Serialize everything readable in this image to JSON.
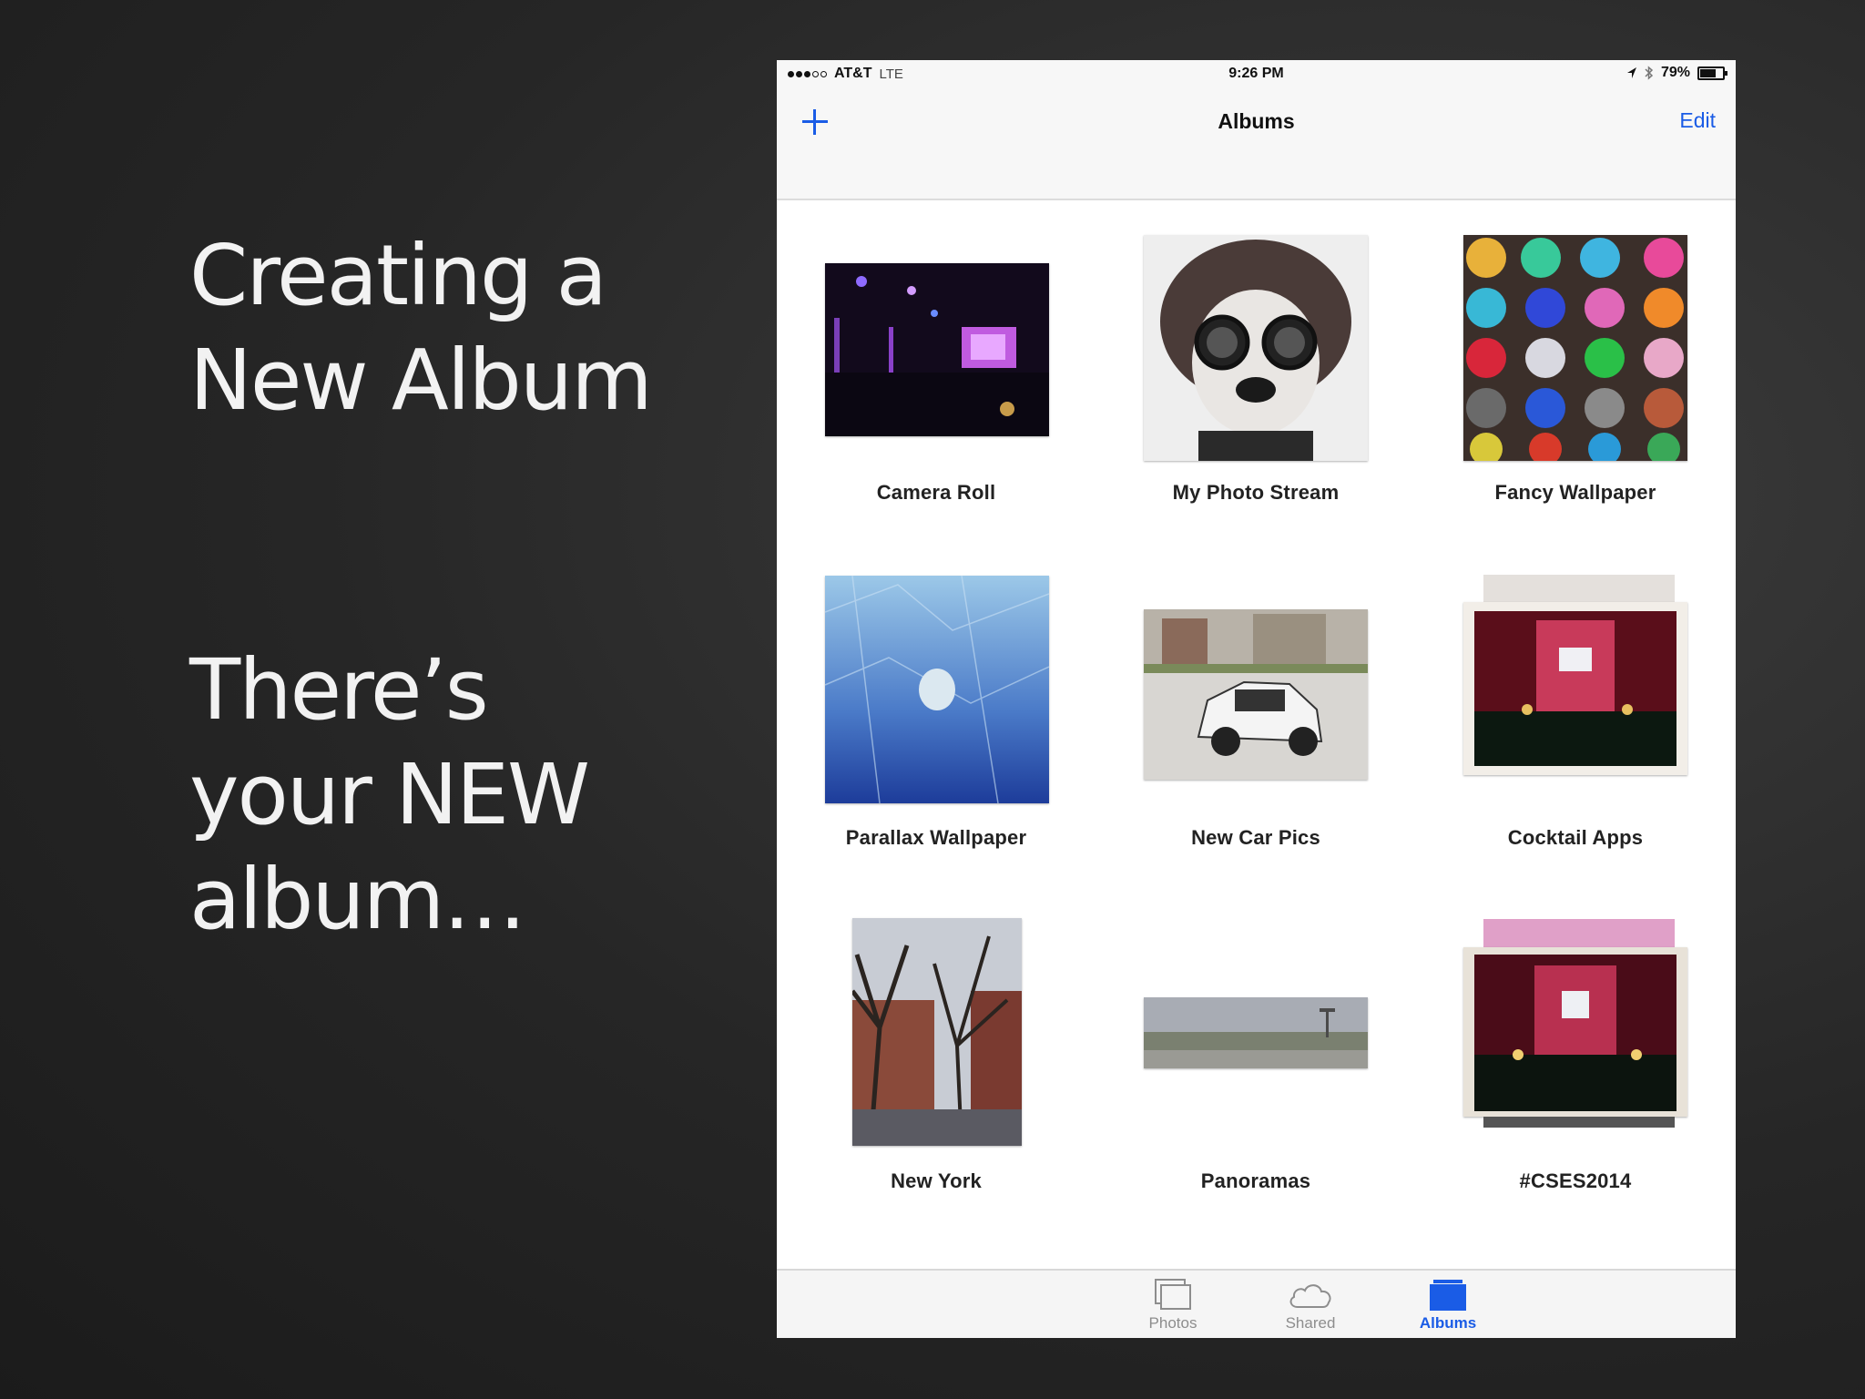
{
  "slide": {
    "heading_lines": [
      "Creating a",
      "New Album"
    ],
    "subheading_lines": [
      "There’s",
      "your NEW",
      "album…"
    ]
  },
  "status_bar": {
    "carrier": "AT&T",
    "network": "LTE",
    "time": "9:26 PM",
    "battery": "79%",
    "battery_level": 0.79,
    "icons": [
      "location-arrow-icon",
      "bluetooth-icon",
      "battery-icon"
    ]
  },
  "nav": {
    "title": "Albums",
    "edit_label": "Edit",
    "add_icon": "plus-icon"
  },
  "albums": [
    {
      "label": "Camera Roll"
    },
    {
      "label": "My Photo Stream"
    },
    {
      "label": "Fancy Wallpaper"
    },
    {
      "label": "Parallax Wallpaper"
    },
    {
      "label": "New Car Pics"
    },
    {
      "label": "Cocktail Apps"
    },
    {
      "label": "New York"
    },
    {
      "label": "Panoramas"
    },
    {
      "label": "#CSES2014"
    }
  ],
  "tabs": [
    {
      "label": "Photos",
      "icon": "photos-icon",
      "active": false
    },
    {
      "label": "Shared",
      "icon": "cloud-icon",
      "active": false
    },
    {
      "label": "Albums",
      "icon": "albums-icon",
      "active": true
    }
  ],
  "colors": {
    "accent": "#1a5ce6",
    "tab_inactive": "#8d8d8d"
  }
}
